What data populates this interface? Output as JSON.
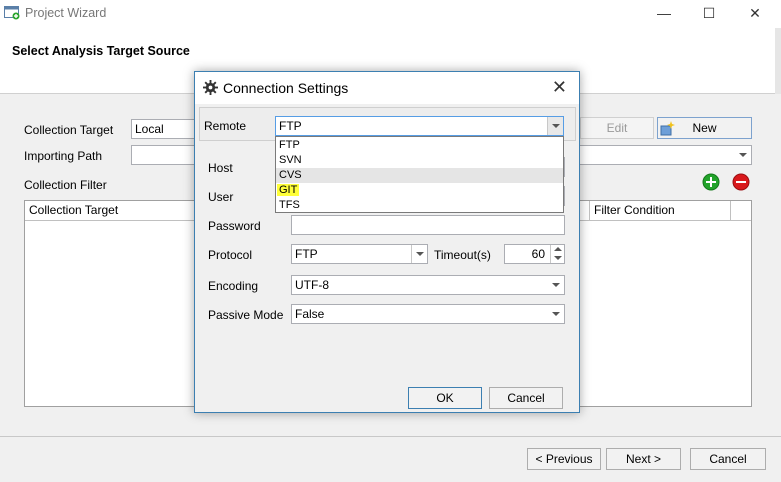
{
  "window": {
    "title": "Project Wizard",
    "header": "Select Analysis Target Source",
    "minimize": "—",
    "maximize": "☐",
    "close": "✕"
  },
  "form": {
    "collection_target_label": "Collection Target",
    "collection_target_value": "Local",
    "importing_path_label": "Importing Path",
    "importing_path_value": "",
    "collection_filter_label": "Collection Filter",
    "edit_button": "Edit",
    "new_button": "New"
  },
  "grid": {
    "columns": [
      "Collection Target",
      "Filter Condition"
    ]
  },
  "footer": {
    "previous_button": "< Previous",
    "next_button": "Next >",
    "cancel_button": "Cancel"
  },
  "dialog": {
    "title": "Connection Settings",
    "close": "✕",
    "remote_label": "Remote",
    "remote_value": "FTP",
    "remote_options": [
      "FTP",
      "SVN",
      "CVS",
      "GIT",
      "TFS"
    ],
    "host_label": "Host",
    "user_label": "User",
    "password_label": "Password",
    "protocol_label": "Protocol",
    "protocol_value": "FTP",
    "timeout_label": "Timeout(s)",
    "timeout_value": "60",
    "encoding_label": "Encoding",
    "encoding_value": "UTF-8",
    "passive_label": "Passive Mode",
    "passive_value": "False",
    "ok_button": "OK",
    "cancel_button": "Cancel"
  },
  "colors": {
    "dialog_border": "#3c7fb1",
    "add_icon": "#22a32a",
    "remove_icon": "#d9191c",
    "highlight": "#ffff3a"
  }
}
